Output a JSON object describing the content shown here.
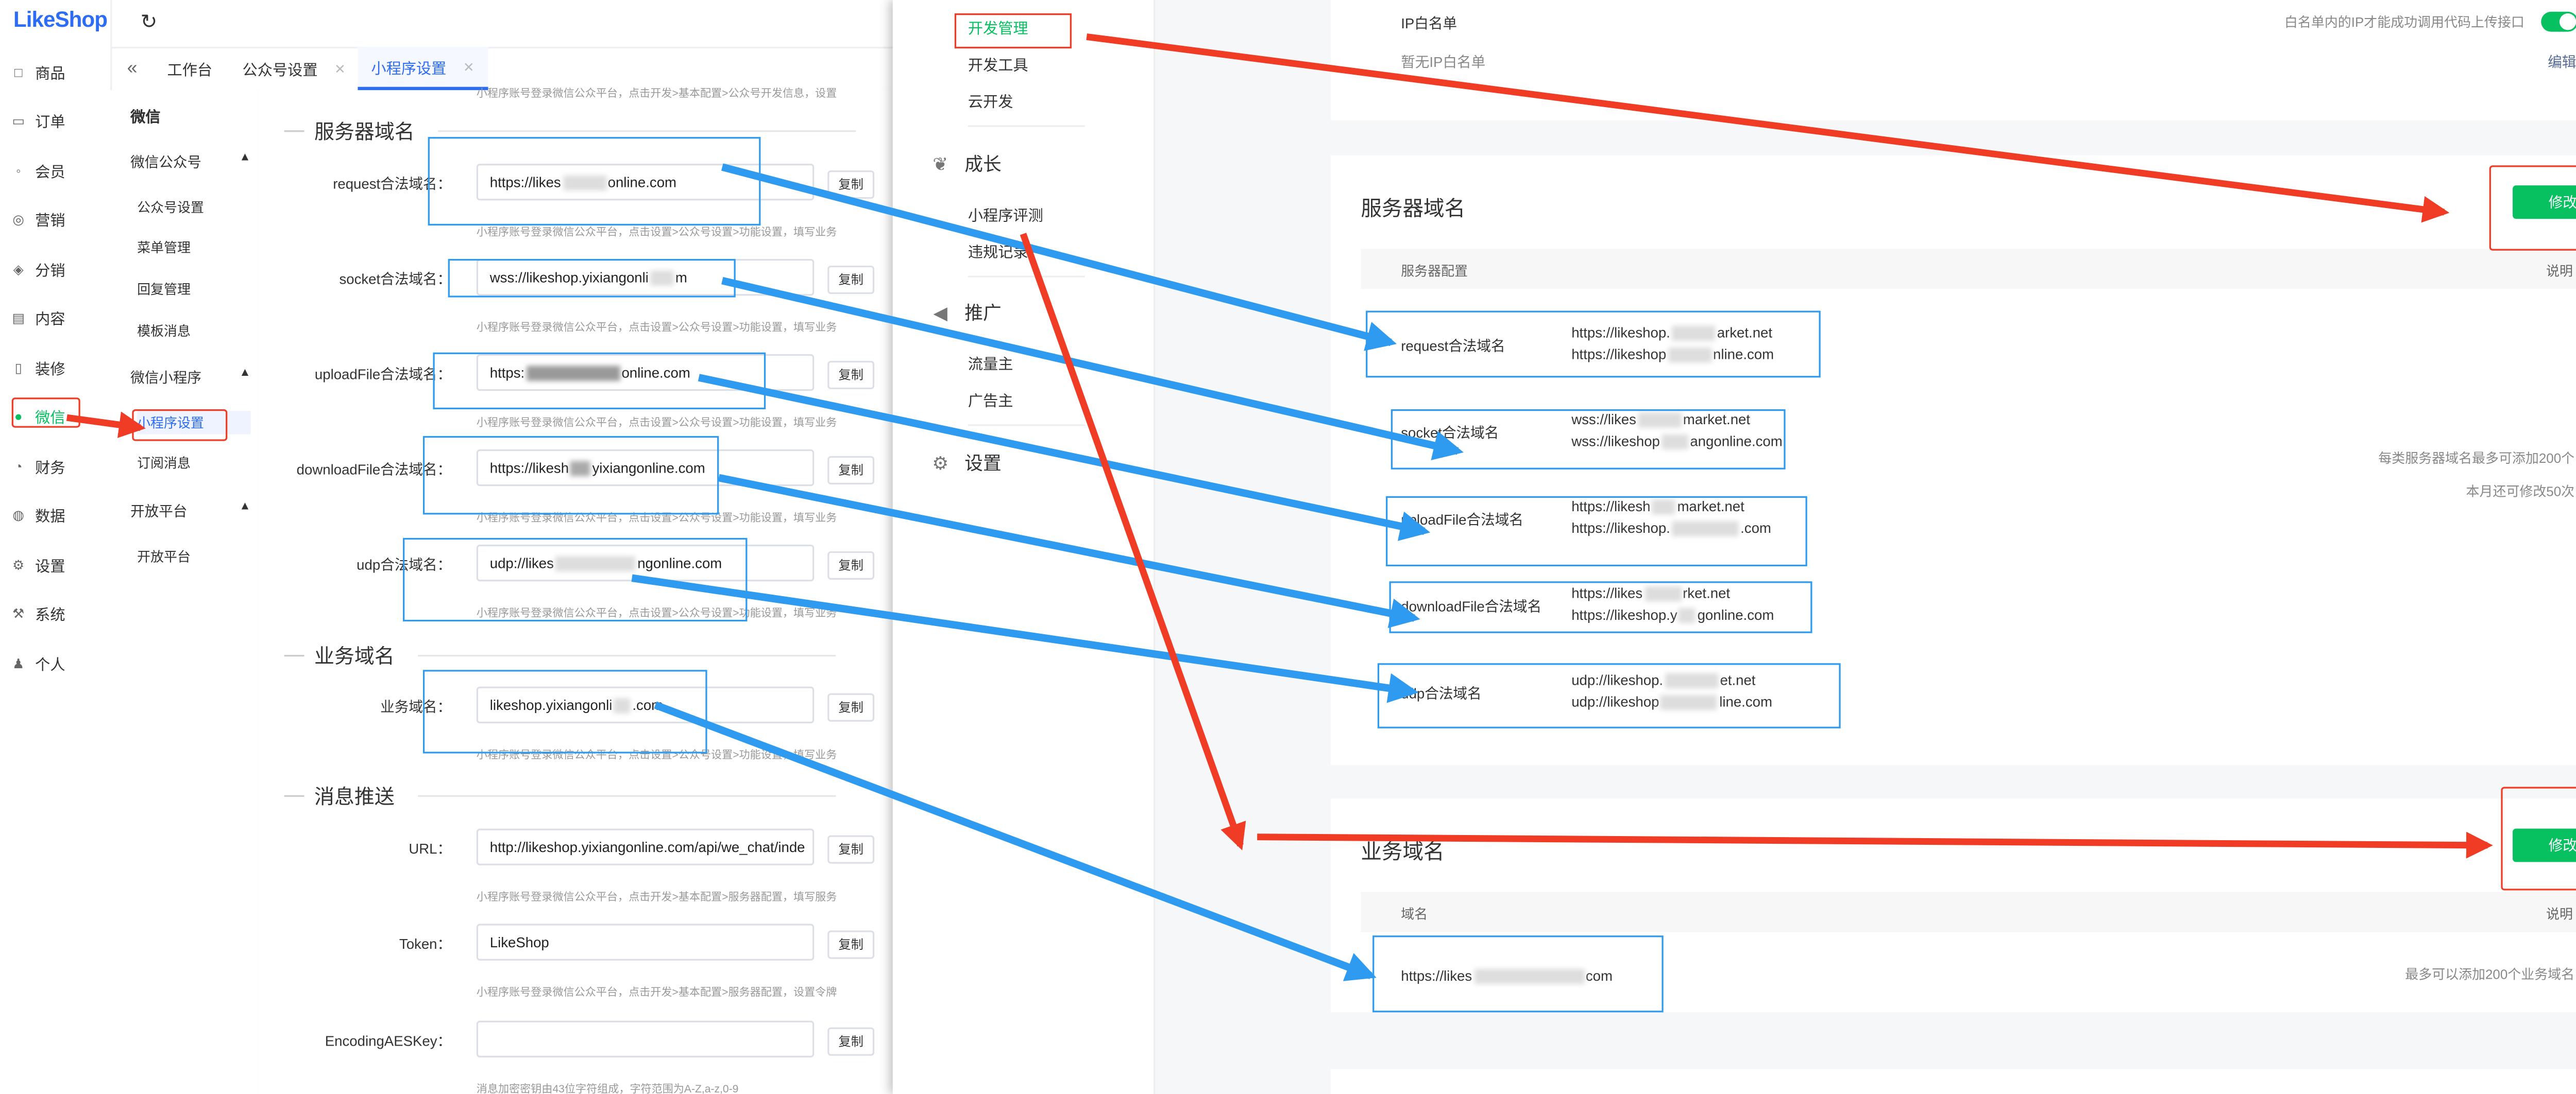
{
  "admin": {
    "logo": "LikeShop",
    "nav": [
      "商品",
      "订单",
      "会员",
      "营销",
      "分销",
      "内容",
      "装修",
      "微信",
      "财务",
      "数据",
      "设置",
      "系统",
      "个人"
    ],
    "tabs": [
      "工作台",
      "公众号设置",
      "小程序设置"
    ],
    "sub_nav": {
      "head": "微信",
      "group1": "微信公众号",
      "group1_items": [
        "公众号设置",
        "菜单管理",
        "回复管理",
        "模板消息"
      ],
      "group2": "微信小程序",
      "group2_items": [
        "小程序设置",
        "订阅消息"
      ],
      "group3": "开放平台",
      "group3_items": [
        "开放平台"
      ]
    },
    "top_hint": "小程序账号登录微信公众平台，点击开发>基本配置>公众号开发信息，设置",
    "sections": {
      "server": "服务器域名",
      "business": "业务域名",
      "push": "消息推送"
    },
    "fields": {
      "request": {
        "label": "request合法域名：",
        "value": "https://likes",
        "value2": "online.com"
      },
      "socket": {
        "label": "socket合法域名：",
        "value": "wss://likeshop.yixiangonli",
        "value2": "m"
      },
      "upload": {
        "label": "uploadFile合法域名：",
        "value": "https:",
        "value2": "online.com"
      },
      "download": {
        "label": "downloadFile合法域名：",
        "value": "https://likesh",
        "value2": "yixiangonline.com"
      },
      "udp": {
        "label": "udp合法域名：",
        "value": "udp://likes",
        "value2": "ngonline.com"
      },
      "business": {
        "label": "业务域名：",
        "value": "likeshop.yixiangonli",
        "value2": ".com"
      },
      "url": {
        "label": "URL：",
        "value": "http://likeshop.yixiangonline.com/api/we_chat/inde"
      },
      "token": {
        "label": "Token：",
        "value": "LikeShop"
      },
      "aes": {
        "label": "EncodingAESKey：",
        "value": ""
      }
    },
    "copy": "复制",
    "hint_domain": "小程序账号登录微信公众平台，点击设置>公众号设置>功能设置，填写业务",
    "hint_server": "小程序账号登录微信公众平台，点击开发>基本配置>服务器配置，填写服务",
    "hint_token": "小程序账号登录微信公众平台，点击开发>基本配置>服务器配置，设置令牌",
    "hint_aes": "消息加密密钥由43位字符组成，字符范围为A-Z,a-z,0-9"
  },
  "wechat": {
    "side": {
      "dev_items": [
        "开发管理",
        "开发工具",
        "云开发"
      ],
      "grow": "成长",
      "grow_items": [
        "小程序评测",
        "违规记录"
      ],
      "promo": "推广",
      "promo_items": [
        "流量主",
        "广告主"
      ],
      "settings": "设置"
    },
    "ip": {
      "label": "IP白名单",
      "empty": "暂无IP白名单",
      "note": "白名单内的IP才能成功调用代码上传接口",
      "edit": "编辑"
    },
    "server": {
      "title": "服务器域名",
      "modify": "修改",
      "col1": "服务器配置",
      "col2": "说明",
      "rows": [
        {
          "label": "request合法域名",
          "v1": "https://likeshop.",
          "v1b": "arket.net",
          "v2": "https://likeshop",
          "v2b": "nline.com"
        },
        {
          "label": "socket合法域名",
          "v1": "wss://likes",
          "v1b": "market.net",
          "v2": "wss://likeshop",
          "v2b": "angonline.com"
        },
        {
          "label": "uploadFile合法域名",
          "v1": "https://likesh",
          "v1b": "market.net",
          "v2": "https://likeshop.",
          "v2b": ".com"
        },
        {
          "label": "downloadFile合法域名",
          "v1": "https://likes",
          "v1b": "rket.net",
          "v2": "https://likeshop.y",
          "v2b": "gonline.com"
        },
        {
          "label": "udp合法域名",
          "v1": "udp://likeshop.",
          "v1b": "et.net",
          "v2": "udp://likeshop",
          "v2b": "line.com"
        }
      ],
      "note1": "每类服务器域名最多可添加200个",
      "note2": "本月还可修改50次"
    },
    "business": {
      "title": "业务域名",
      "modify": "修改",
      "col1": "域名",
      "col2": "说明",
      "value": "https://likes",
      "value2": "com",
      "note": "最多可以添加200个业务域名"
    }
  },
  "colors": {
    "accent": "#2d6cf5",
    "green": "#07c160",
    "arrow_blue": "#2f9bf0",
    "arrow_red": "#f03b25"
  },
  "icons": [
    "refresh-icon",
    "collapse-icon",
    "caret-up-icon",
    "leaf-icon",
    "megaphone-icon",
    "gear-icon",
    "toggle-switch"
  ]
}
